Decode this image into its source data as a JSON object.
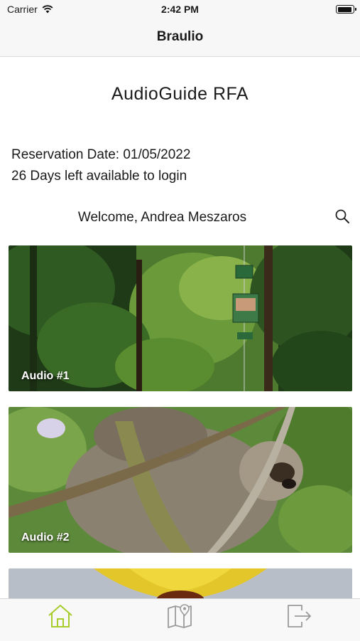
{
  "status_bar": {
    "carrier": "Carrier",
    "time": "2:42 PM"
  },
  "nav": {
    "title": "Braulio"
  },
  "main": {
    "app_title": "AudioGuide RFA",
    "reservation_date": "Reservation Date: 01/05/2022",
    "days_left": "26 Days left available to login",
    "welcome": "Welcome, Andrea Meszaros"
  },
  "cards": [
    {
      "label": "Audio #1",
      "image": "rainforest-aerial-tram"
    },
    {
      "label": "Audio #2",
      "image": "sloth-on-branch"
    },
    {
      "label": "",
      "image": "yellow-flower"
    }
  ],
  "tabs": [
    {
      "icon": "home-icon",
      "active": true
    },
    {
      "icon": "map-icon",
      "active": false
    },
    {
      "icon": "logout-icon",
      "active": false
    }
  ],
  "colors": {
    "active_tab": "#a8cc2c",
    "inactive_tab": "#9a9a9a"
  }
}
